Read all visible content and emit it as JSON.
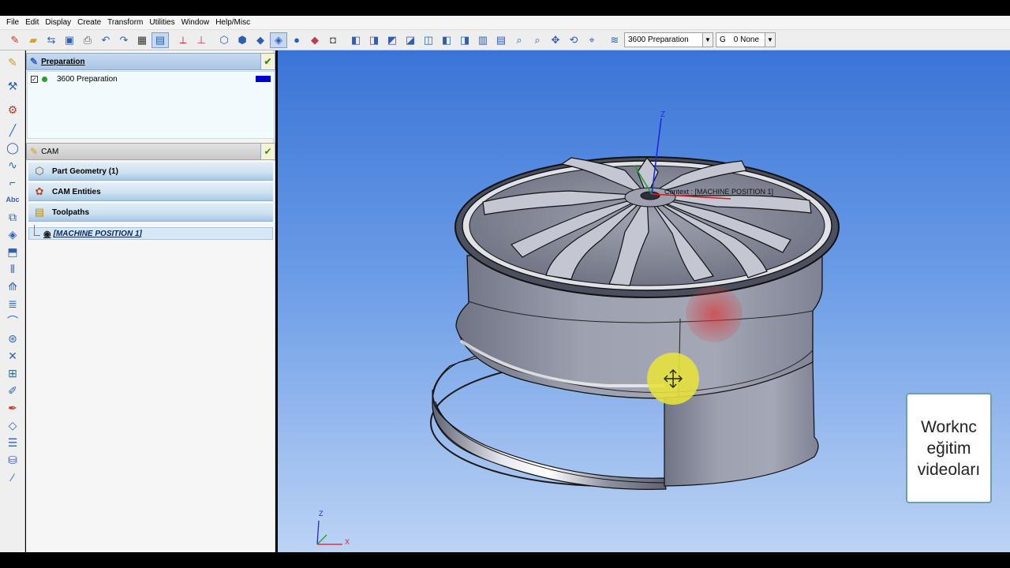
{
  "menubar": {
    "items": [
      "File",
      "Edit",
      "Display",
      "Create",
      "Transform",
      "Utilities",
      "Window",
      "Help/Misc"
    ]
  },
  "toolbar": {
    "layer_combo": "3600  Preparation",
    "group_label": "G",
    "group_combo": "0 None"
  },
  "preparation": {
    "header": "Preparation",
    "row_label": "3600 Preparation",
    "row_checked": true,
    "swatch_color": "#0000d0"
  },
  "cam": {
    "header": "CAM",
    "items": [
      "Part Geometry (1)",
      "CAM Entities",
      "Toolpaths"
    ],
    "machine_position": "[MACHINE POSITION 1]"
  },
  "viewport": {
    "context_label": "Context : [MACHINE POSITION 1]",
    "axis_z": "Z",
    "mini_axis_z": "Z",
    "mini_axis_x": "X"
  },
  "watermark": {
    "line1": "Worknc",
    "line2": "eğitim",
    "line3": "videoları"
  }
}
